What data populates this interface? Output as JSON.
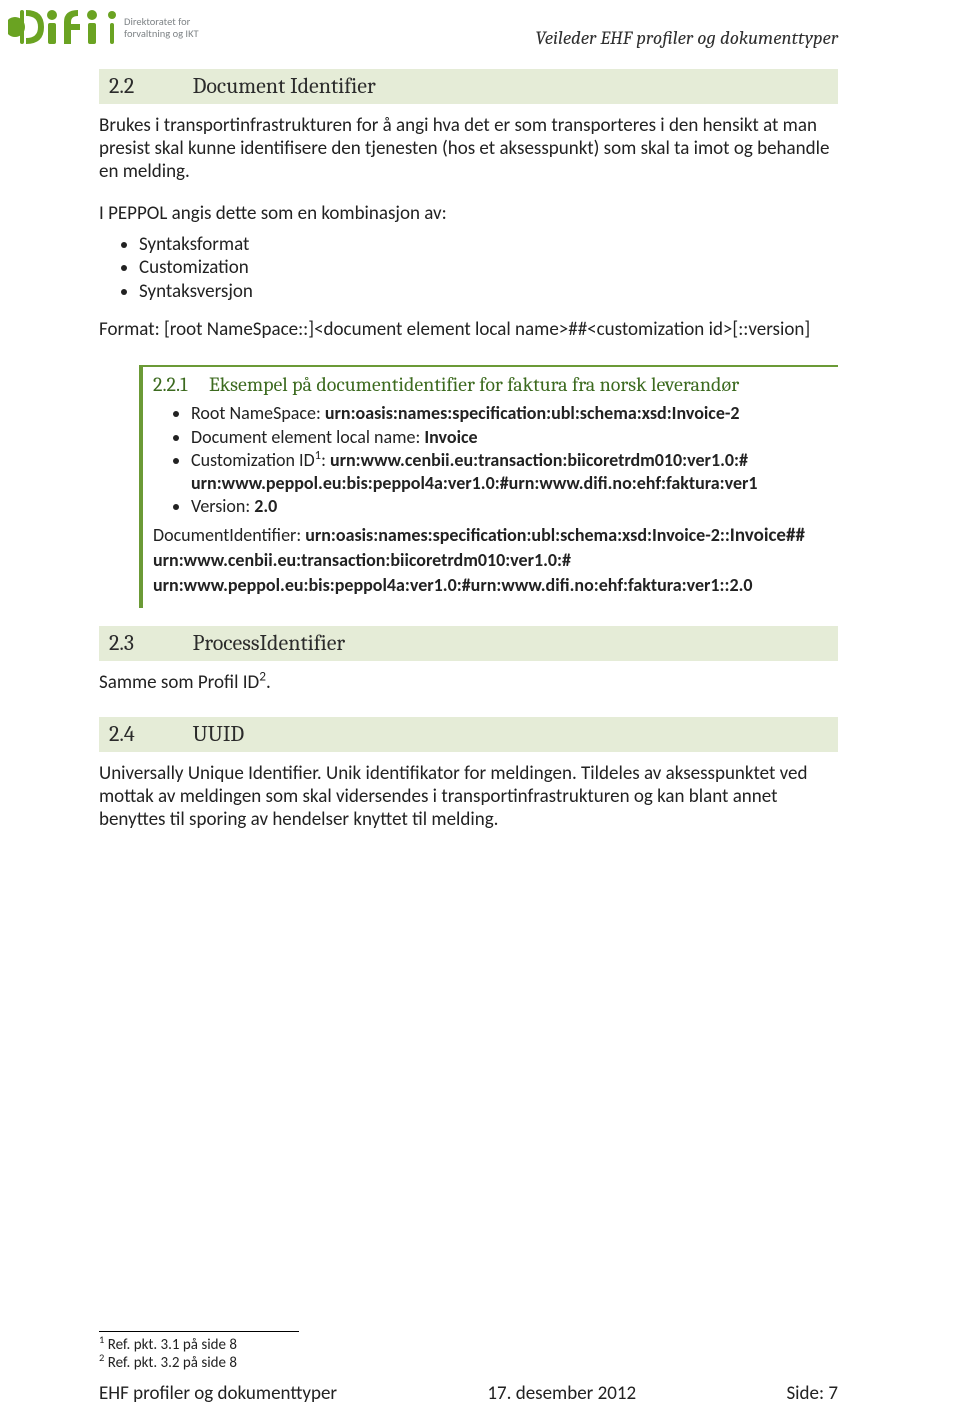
{
  "header": {
    "logo_line1": "Direktoratet for",
    "logo_line2": "forvaltning og IKT",
    "doc_title": "Veileder EHF profiler og dokumenttyper"
  },
  "s22": {
    "num": "2.2",
    "title": "Document Identifier",
    "p1": "Brukes i transportinfrastrukturen for å angi hva det er som transporteres i den hensikt at man presist skal kunne identifisere den tjenesten (hos et aksesspunkt) som skal ta imot og behandle en melding.",
    "p2": "I PEPPOL angis dette som en kombinasjon av:",
    "bullets": [
      "Syntaksformat",
      "Customization",
      "Syntaksversjon"
    ],
    "p3": "Format: [root NameSpace::]<document element local name>##<customization id>[::version]"
  },
  "s221": {
    "num": "2.2.1",
    "title": "Eksempel på documentidentifier for faktura fra norsk leverandør",
    "b1_a": "Root NameSpace: ",
    "b1_b": "urn:oasis:names:specification:ubl:schema:xsd:Invoice-2",
    "b2_a": "Document element local name: ",
    "b2_b": "Invoice",
    "b3_a": "Customization ID",
    "b3_sup": "1",
    "b3_b": ": ",
    "b3_c": "urn:www.cenbii.eu:transaction:biicoretrdm010:ver1.0:# urn:www.peppol.eu:bis:peppol4a:ver1.0:#urn:www.difi.no:ehf:faktura:ver1",
    "b4_a": "Version: ",
    "b4_b": "2.0",
    "tail1_a": "DocumentIdentifier: ",
    "tail1_b": "urn:oasis:names:specification:ubl:schema:xsd:Invoice-2::",
    "tail1_c": "Invoice##",
    "tail2": "urn:www.cenbii.eu:transaction:biicoretrdm010:ver1.0:#",
    "tail3": "urn:www.peppol.eu:bis:peppol4a:ver1.0:#urn:www.difi.no:ehf:faktura:ver1::2.0"
  },
  "s23": {
    "num": "2.3",
    "title": "ProcessIdentifier",
    "p1_a": "Samme som Profil ID",
    "p1_sup": "2",
    "p1_b": "."
  },
  "s24": {
    "num": "2.4",
    "title": "UUID",
    "p1": "Universally Unique Identifier.  Unik identifikator for meldingen.  Tildeles av aksesspunktet ved mottak av meldingen som skal vidersendes i transportinfrastrukturen og kan blant annet benyttes til sporing av hendelser knyttet til melding."
  },
  "footnotes": {
    "f1_sup": "1",
    "f1": " Ref. pkt. 3.1 på side 8",
    "f2_sup": "2",
    "f2": " Ref. pkt. 3.2 på side 8"
  },
  "footer": {
    "left": "EHF profiler og dokumenttyper",
    "center": "17. desember 2012",
    "right": "Side: 7"
  }
}
